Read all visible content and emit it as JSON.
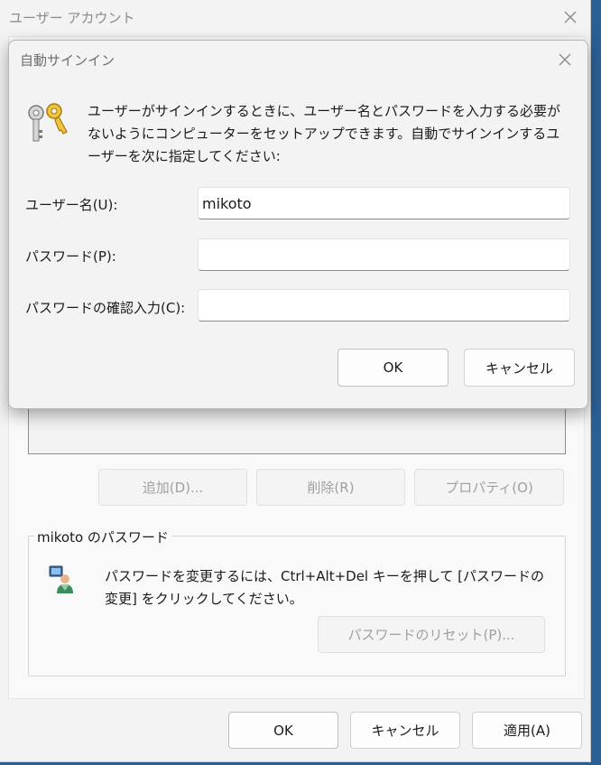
{
  "background_window": {
    "title": "ユーザー アカウント",
    "buttons": {
      "add": "追加(D)...",
      "remove": "削除(R)",
      "properties": "プロパティ(O)"
    },
    "password_group": {
      "title": "mikoto のパスワード",
      "description": "パスワードを変更するには、Ctrl+Alt+Del キーを押して [パスワードの変更] をクリックしてください。",
      "reset_button": "パスワードのリセット(P)..."
    },
    "footer": {
      "ok": "OK",
      "cancel": "キャンセル",
      "apply": "適用(A)"
    }
  },
  "dialog": {
    "title": "自動サインイン",
    "description": "ユーザーがサインインするときに、ユーザー名とパスワードを入力する必要がないようにコンピューターをセットアップできます。自動でサインインするユーザーを次に指定してください:",
    "fields": {
      "username_label": "ユーザー名(U):",
      "username_value": "mikoto",
      "password_label": "パスワード(P):",
      "password_value": "",
      "confirm_label": "パスワードの確認入力(C):",
      "confirm_value": ""
    },
    "ok": "OK",
    "cancel": "キャンセル"
  }
}
